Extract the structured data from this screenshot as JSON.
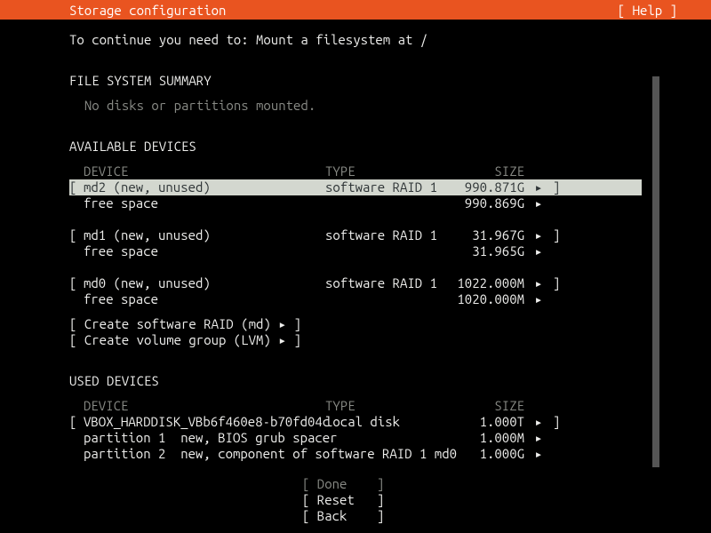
{
  "header": {
    "title": "Storage configuration",
    "help": "[ Help ]"
  },
  "instruction": "To continue you need to: Mount a filesystem at /",
  "fss": {
    "heading": "FILE SYSTEM SUMMARY",
    "empty": "No disks or partitions mounted."
  },
  "avail": {
    "heading": "AVAILABLE DEVICES",
    "cols": {
      "device": "DEVICE",
      "type": "TYPE",
      "size": "SIZE"
    },
    "devices": [
      {
        "name": "md2 (new, unused)",
        "type": "software RAID 1",
        "size": "990.871G",
        "selected": true,
        "free": {
          "label": "free space",
          "size": "990.869G"
        }
      },
      {
        "name": "md1 (new, unused)",
        "type": "software RAID 1",
        "size": "31.967G",
        "selected": false,
        "free": {
          "label": "free space",
          "size": "31.965G"
        }
      },
      {
        "name": "md0 (new, unused)",
        "type": "software RAID 1",
        "size": "1022.000M",
        "selected": false,
        "free": {
          "label": "free space",
          "size": "1020.000M"
        }
      }
    ],
    "actions": [
      "[ Create software RAID (md) ▸ ]",
      "[ Create volume group (LVM) ▸ ]"
    ]
  },
  "used": {
    "heading": "USED DEVICES",
    "cols": {
      "device": "DEVICE",
      "type": "TYPE",
      "size": "SIZE"
    },
    "device": {
      "name": "VBOX_HARDDISK_VBb6f460e8-b70fd04c",
      "type": "local disk",
      "size": "1.000T",
      "parts": [
        {
          "desc": "partition 1  new, BIOS grub spacer",
          "size": "1.000M"
        },
        {
          "desc": "partition 2  new, component of software RAID 1 md0",
          "size": "1.000G"
        }
      ]
    }
  },
  "footer": {
    "done": "[ Done    ]",
    "reset": "[ Reset   ]",
    "back": "[ Back    ]"
  },
  "arrow": "▸"
}
